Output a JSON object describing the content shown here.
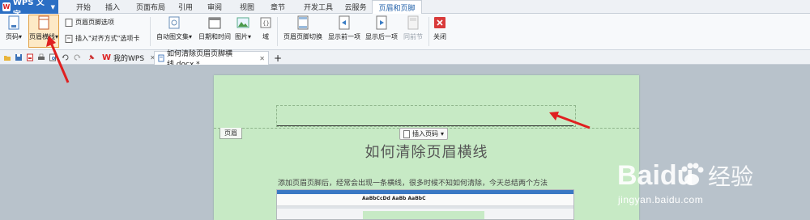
{
  "menubar": {
    "app_name": "WPS 文字",
    "tabs": [
      "开始",
      "插入",
      "页面布局",
      "引用",
      "审阅",
      "视图",
      "章节",
      "开发工具",
      "云服务",
      "页眉和页脚"
    ],
    "active_tab": "页眉和页脚"
  },
  "ribbon": {
    "page_number": "页码",
    "header_line": "页眉横线",
    "header_footer_options": "页眉页脚选项",
    "insert_align_tab": "插入\"对齐方式\"选项卡",
    "auto_text": "自动图文集",
    "date_time": "日期和时间",
    "picture": "图片",
    "field": "域",
    "switch_header_footer": "页眉页脚切换",
    "show_prev": "显示前一项",
    "show_next": "显示后一项",
    "same_prev": "同前节",
    "close": "关闭"
  },
  "tabs": {
    "my_wps": "我的WPS",
    "document": "如何清除页眉页脚横线.docx *",
    "add": "+"
  },
  "document": {
    "header_tag": "页眉",
    "insert_page_number": "插入页码",
    "title": "如何清除页眉横线",
    "body_text": "添加页眉页脚后，经常会出现一条横线，很多时候不知如何清除，今天总结两个方法",
    "embedded_font_sample": "AaBbCcDd AaBb AaBbC"
  },
  "watermark": {
    "brand": "Baidu",
    "brand_cn": "经验",
    "url": "jingyan.baidu.com"
  },
  "colors": {
    "accent": "#2b6fc4",
    "page_bg": "#c7eac5",
    "arrow": "#e02020",
    "close_red": "#d93b3b"
  }
}
